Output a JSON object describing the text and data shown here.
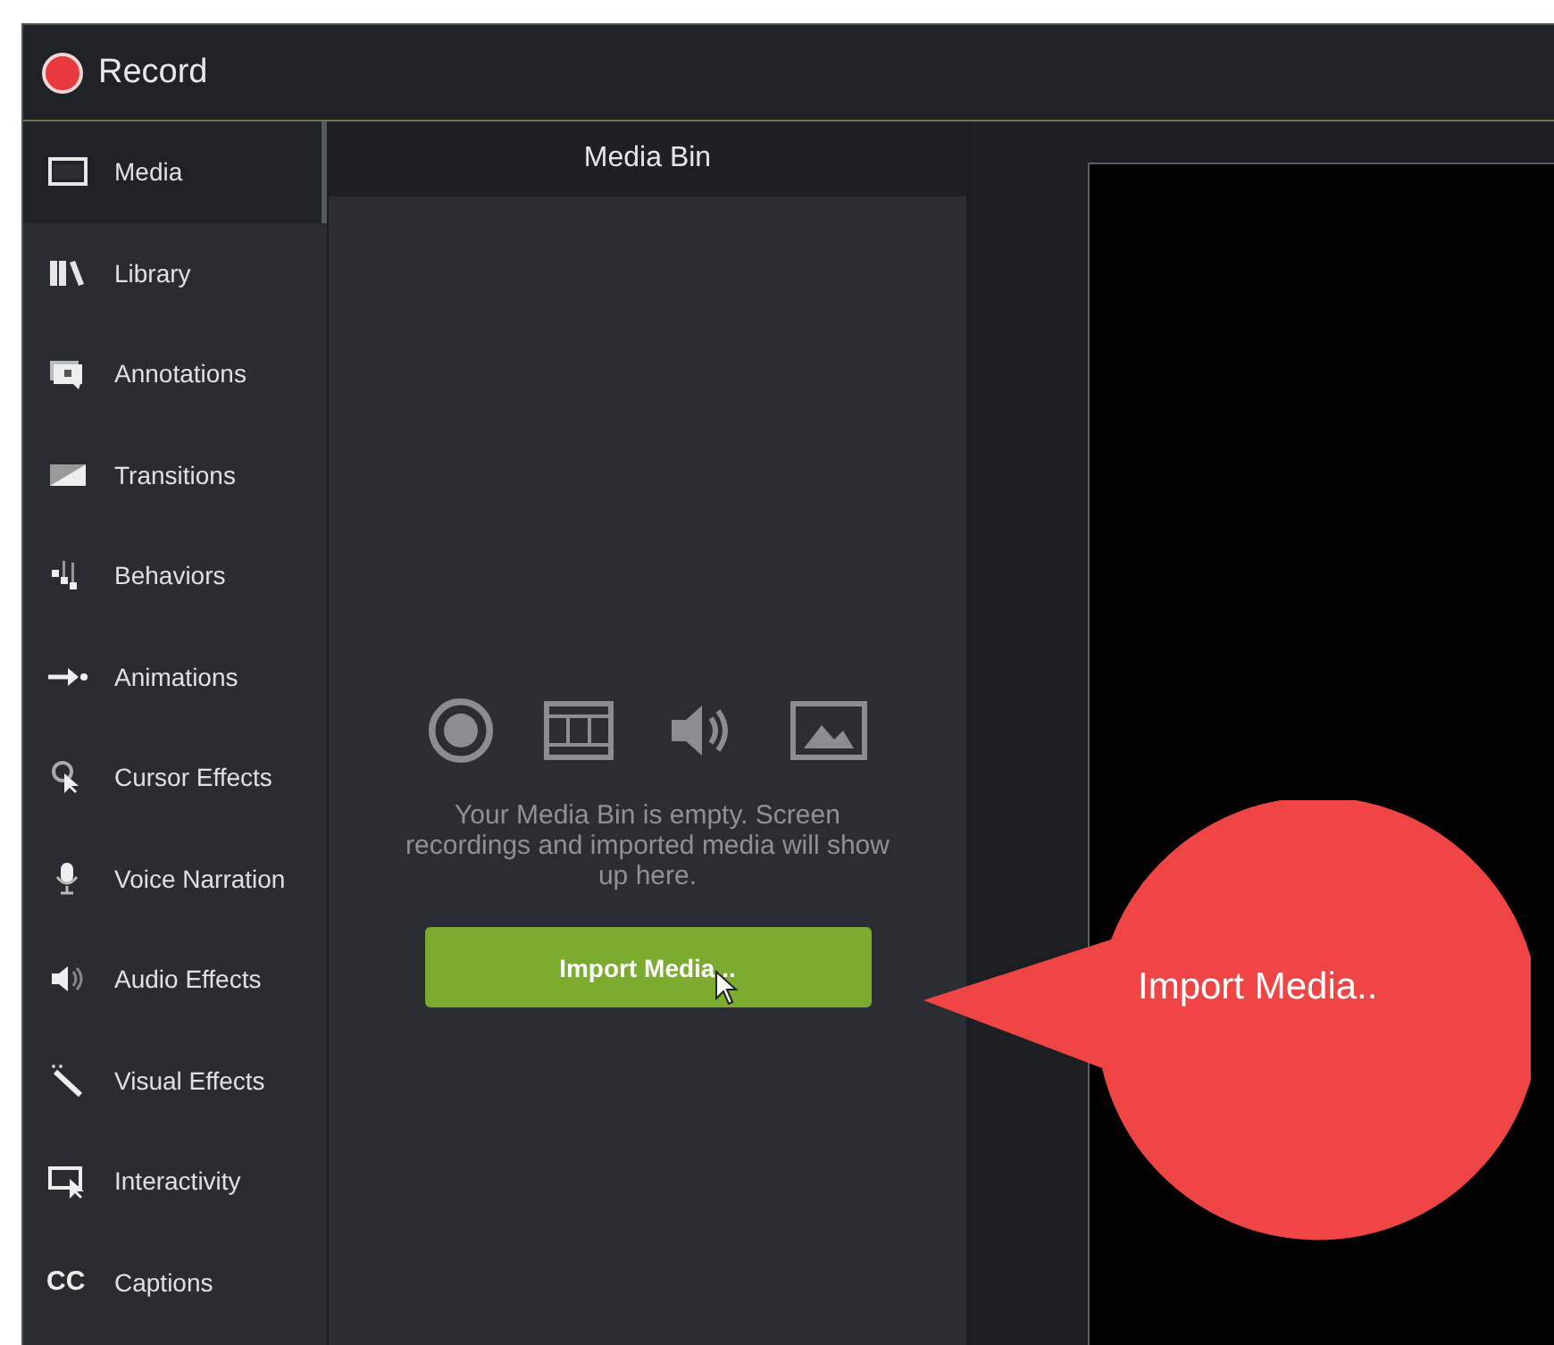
{
  "window": {
    "title": "Record"
  },
  "sidebar": {
    "items": [
      {
        "label": "Media",
        "selected": true
      },
      {
        "label": "Library",
        "selected": false
      },
      {
        "label": "Annotations",
        "selected": false
      },
      {
        "label": "Transitions",
        "selected": false
      },
      {
        "label": "Behaviors",
        "selected": false
      },
      {
        "label": "Animations",
        "selected": false
      },
      {
        "label": "Cursor Effects",
        "selected": false
      },
      {
        "label": "Voice Narration",
        "selected": false
      },
      {
        "label": "Audio Effects",
        "selected": false
      },
      {
        "label": "Visual Effects",
        "selected": false
      },
      {
        "label": "Interactivity",
        "selected": false
      },
      {
        "label": "Captions",
        "selected": false,
        "glyph": "CC"
      }
    ]
  },
  "media_bin": {
    "title": "Media Bin",
    "empty_message": "Your Media Bin is empty. Screen recordings and imported media will show up here.",
    "import_button": "Import Media..."
  },
  "callout": {
    "text": "Import Media.."
  }
}
